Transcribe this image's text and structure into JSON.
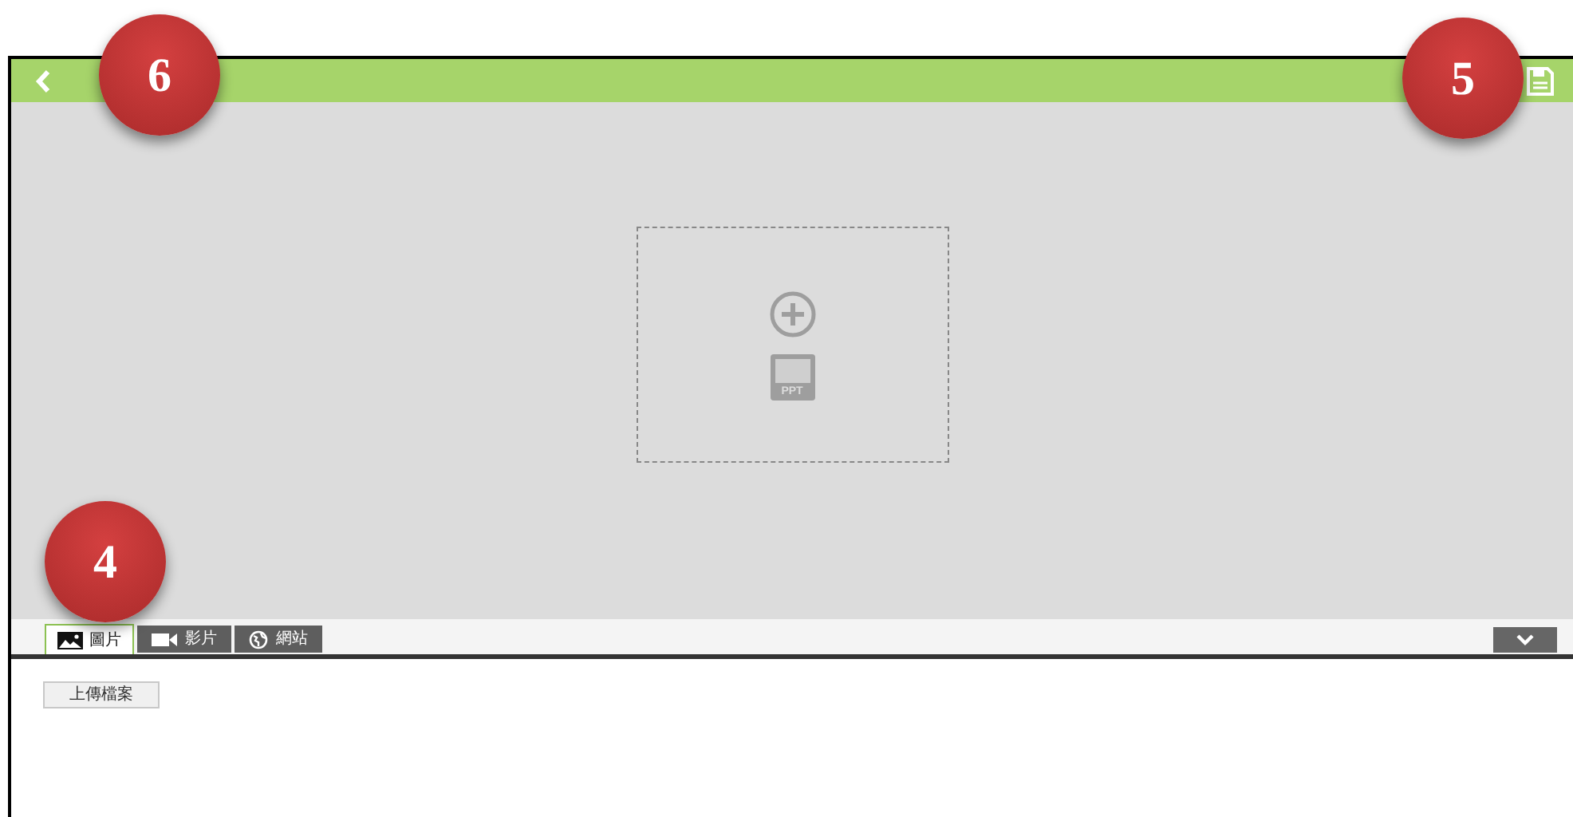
{
  "slide_placeholder": {
    "icon_label": "PPT"
  },
  "tabs": [
    {
      "label": "圖片",
      "kind": "image",
      "selected": true
    },
    {
      "label": "影片",
      "kind": "video",
      "selected": false
    },
    {
      "label": "網站",
      "kind": "web",
      "selected": false
    }
  ],
  "upload_button": "上傳檔案",
  "callouts": [
    {
      "number": "6"
    },
    {
      "number": "5"
    },
    {
      "number": "4"
    }
  ]
}
